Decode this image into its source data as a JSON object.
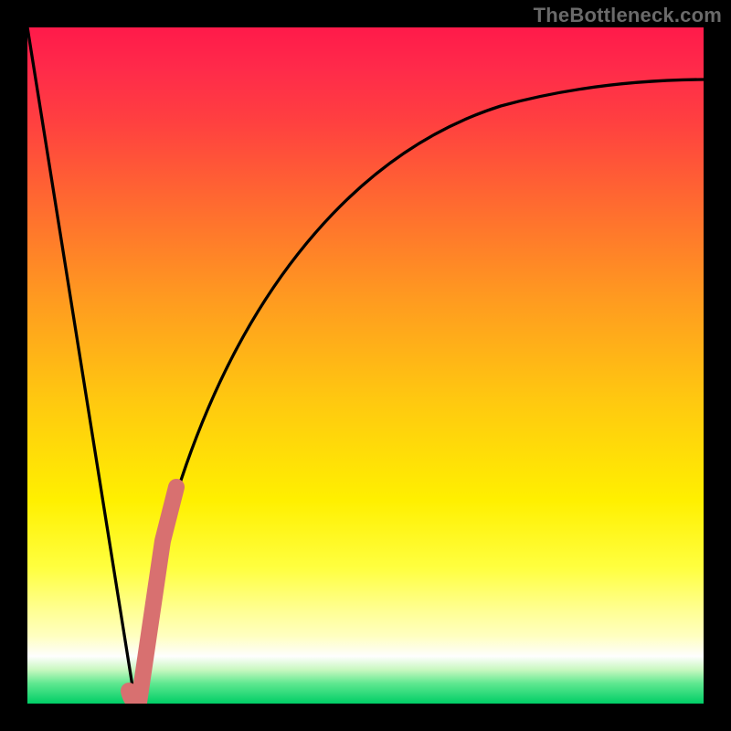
{
  "attribution": "TheBottleneck.com",
  "colors": {
    "frame": "#000000",
    "gradient_top": "#ff1a4a",
    "gradient_mid": "#fff000",
    "gradient_bottom": "#00ce66",
    "curve": "#000000",
    "highlight": "#d87070"
  },
  "chart_data": {
    "type": "line",
    "title": "",
    "xlabel": "",
    "ylabel": "",
    "xlim": [
      0,
      100
    ],
    "ylim": [
      0,
      100
    ],
    "series": [
      {
        "name": "left-slope",
        "x": [
          0,
          16
        ],
        "y": [
          100,
          0
        ]
      },
      {
        "name": "right-curve",
        "x": [
          16,
          20,
          25,
          30,
          35,
          40,
          45,
          50,
          55,
          60,
          65,
          70,
          75,
          80,
          85,
          90,
          95,
          100
        ],
        "y": [
          0,
          24,
          44,
          57,
          66,
          72,
          77,
          80,
          83,
          85,
          87,
          88.5,
          89.5,
          90.3,
          91,
          91.5,
          92,
          92.3
        ]
      },
      {
        "name": "highlight-segment",
        "x": [
          15.5,
          16,
          18,
          20,
          22
        ],
        "y": [
          2,
          0,
          12,
          24,
          32
        ]
      }
    ]
  }
}
